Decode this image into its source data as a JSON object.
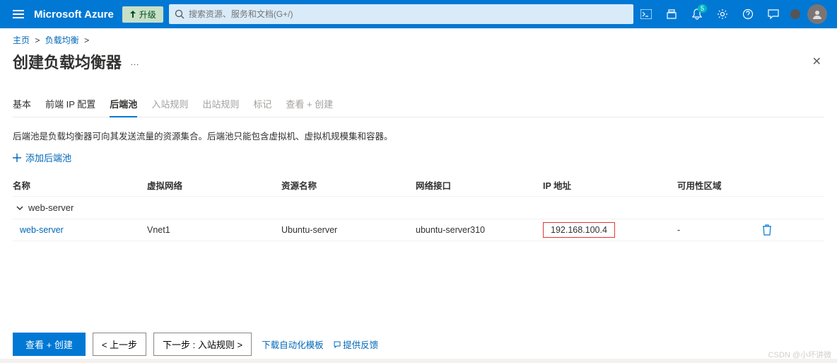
{
  "header": {
    "brand": "Microsoft Azure",
    "upgrade_label": "升级",
    "search_placeholder": "搜索资源、服务和文档(G+/)",
    "notification_count": "5"
  },
  "breadcrumb": {
    "home": "主页",
    "parent": "负载均衡"
  },
  "page": {
    "title": "创建负载均衡器"
  },
  "tabs": [
    "基本",
    "前端 IP 配置",
    "后端池",
    "入站规则",
    "出站规则",
    "标记",
    "查看 + 创建"
  ],
  "active_tab": "后端池",
  "description": "后端池是负载均衡器可向其发送流量的资源集合。后端池只能包含虚拟机、虚拟机规模集和容器。",
  "add_label": "添加后端池",
  "columns": {
    "name": "名称",
    "vnet": "虚拟网络",
    "resource": "资源名称",
    "nic": "网络接口",
    "ip": "IP 地址",
    "zone": "可用性区域"
  },
  "group_name": "web-server",
  "row": {
    "name": "web-server",
    "vnet": "Vnet1",
    "resource": "Ubuntu-server",
    "nic": "ubuntu-server310",
    "ip": "192.168.100.4",
    "zone": "-"
  },
  "footer": {
    "review": "查看 + 创建",
    "prev": "< 上一步",
    "next": "下一步 : 入站规则 >",
    "download": "下载自动化模板",
    "feedback": "提供反馈"
  },
  "watermark": "CSDN @小坏讲微"
}
